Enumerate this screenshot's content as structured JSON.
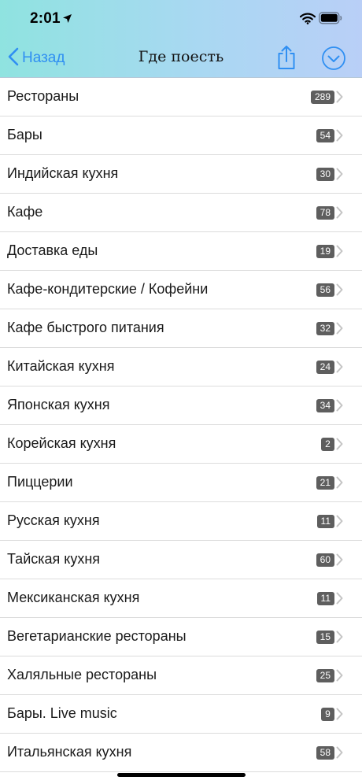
{
  "status_bar": {
    "time": "2:01"
  },
  "nav": {
    "back_label": "Назад",
    "title": "Где поесть"
  },
  "categories": [
    {
      "label": "Рестораны",
      "count": "289"
    },
    {
      "label": "Бары",
      "count": "54"
    },
    {
      "label": "Индийская кухня",
      "count": "30"
    },
    {
      "label": "Кафе",
      "count": "78"
    },
    {
      "label": "Доставка еды",
      "count": "19"
    },
    {
      "label": "Кафе-кондитерские / Кофейни",
      "count": "56"
    },
    {
      "label": "Кафе быстрого питания",
      "count": "32"
    },
    {
      "label": "Китайская кухня",
      "count": "24"
    },
    {
      "label": "Японская кухня",
      "count": "34"
    },
    {
      "label": "Корейская кухня",
      "count": "2"
    },
    {
      "label": "Пиццерии",
      "count": "21"
    },
    {
      "label": "Русская кухня",
      "count": "11"
    },
    {
      "label": "Тайская кухня",
      "count": "60"
    },
    {
      "label": "Мексиканская кухня",
      "count": "11"
    },
    {
      "label": "Вегетарианские рестораны",
      "count": "15"
    },
    {
      "label": "Халяльные рестораны",
      "count": "25"
    },
    {
      "label": "Бары. Live music",
      "count": "9"
    },
    {
      "label": "Итальянская кухня",
      "count": "58"
    }
  ],
  "icons": {
    "back": "chevron-left-icon",
    "share": "share-icon",
    "more": "chevron-down-circle-icon",
    "row_disclosure": "chevron-right-icon"
  },
  "colors": {
    "accent": "#2f8ff2",
    "badge": "#5e5e5e"
  }
}
